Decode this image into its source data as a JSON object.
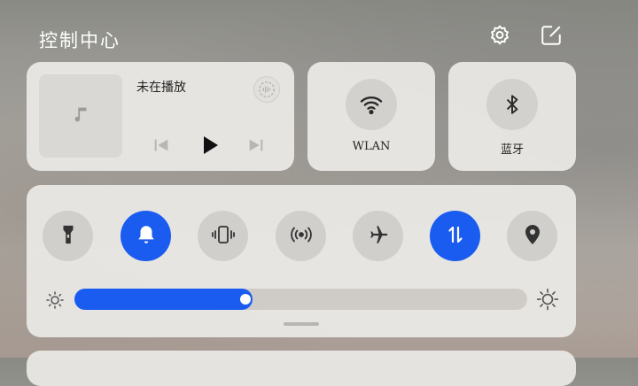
{
  "header": {
    "title": "控制中心",
    "settings_icon": "gear-icon",
    "edit_icon": "edit-icon"
  },
  "media": {
    "status": "未在播放",
    "art_icon": "music-note-icon",
    "source_icon": "audio-source-icon",
    "controls": [
      "previous-icon",
      "play-icon",
      "next-icon"
    ]
  },
  "tiles": {
    "wlan": {
      "label": "WLAN",
      "icon": "wifi-icon"
    },
    "bluetooth": {
      "label": "蓝牙",
      "icon": "bluetooth-icon"
    }
  },
  "toggles": [
    {
      "name": "flashlight",
      "icon": "flashlight-icon",
      "on": false
    },
    {
      "name": "sound",
      "icon": "bell-icon",
      "on": true
    },
    {
      "name": "vibrate",
      "icon": "vibrate-icon",
      "on": false
    },
    {
      "name": "hotspot",
      "icon": "hotspot-icon",
      "on": false
    },
    {
      "name": "airplane",
      "icon": "airplane-icon",
      "on": false
    },
    {
      "name": "mobile-data",
      "icon": "data-arrows-icon",
      "on": true
    },
    {
      "name": "location",
      "icon": "location-pin-icon",
      "on": false
    }
  ],
  "brightness": {
    "level": 0.37
  },
  "colors": {
    "accent": "#1a5cf0",
    "tile_bg": "#eceae7"
  }
}
